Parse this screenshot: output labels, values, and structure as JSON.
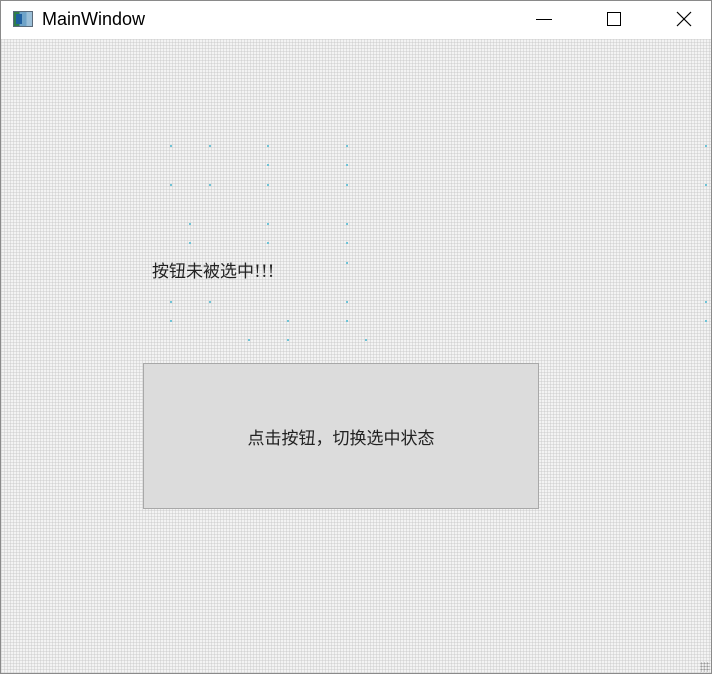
{
  "window": {
    "title": "MainWindow",
    "controls": {
      "minimize_icon": "minimize-icon",
      "maximize_icon": "maximize-icon",
      "close_icon": "close-icon"
    }
  },
  "main": {
    "status_label": "按钮未被选中!!!",
    "toggle_button_label": "点击按钮，切换选中状态",
    "button_checked": false
  },
  "colors": {
    "titlebar_bg": "#ffffff",
    "client_bg": "#f3f3f3",
    "button_bg": "#dcdcdc",
    "button_border": "#a8a8a8",
    "dot_color": "#6ec3d6"
  }
}
